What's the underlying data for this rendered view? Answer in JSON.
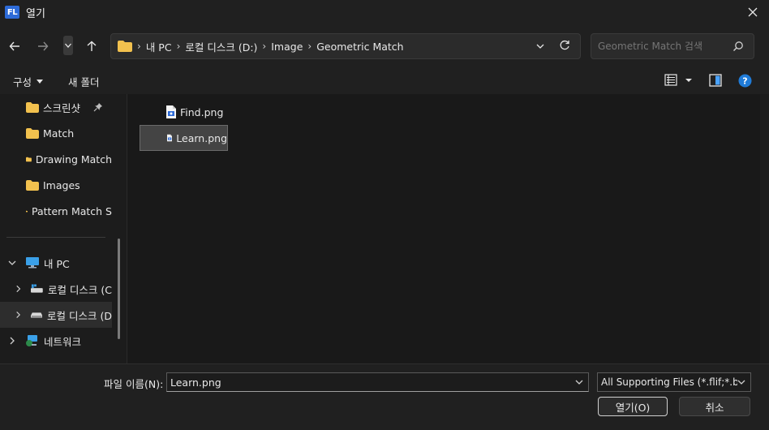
{
  "window": {
    "app_icon_text": "FL",
    "title": "열기"
  },
  "navigation": {
    "breadcrumbs": [
      "내 PC",
      "로컬 디스크 (D:)",
      "Image",
      "Geometric Match"
    ],
    "search_placeholder": "Geometric Match 검색"
  },
  "toolbar": {
    "organize_label": "구성",
    "new_folder_label": "새 폴더"
  },
  "sidebar": {
    "quick_access": [
      {
        "label": "스크린샷",
        "pinned": true
      },
      {
        "label": "Match"
      },
      {
        "label": "Drawing Match"
      },
      {
        "label": "Images"
      },
      {
        "label": "Pattern Match S"
      }
    ],
    "tree": [
      {
        "label": "내 PC",
        "expanded": true
      },
      {
        "label": "로컬 디스크 (C"
      },
      {
        "label": "로컬 디스크 (D",
        "selected": true
      },
      {
        "label": "네트워크"
      }
    ]
  },
  "files": [
    {
      "name": "Find.png",
      "selected": false
    },
    {
      "name": "Learn.png",
      "selected": true
    }
  ],
  "footer": {
    "filename_label": "파일 이름(N):",
    "filename_value": "Learn.png",
    "filetype_value": "All Supporting Files (*.flif;*.bm",
    "open_label": "열기(O)",
    "cancel_label": "취소"
  },
  "colors": {
    "accent": "#2d6bd8",
    "folder": "#f2c14e",
    "help": "#1f7bd8"
  }
}
